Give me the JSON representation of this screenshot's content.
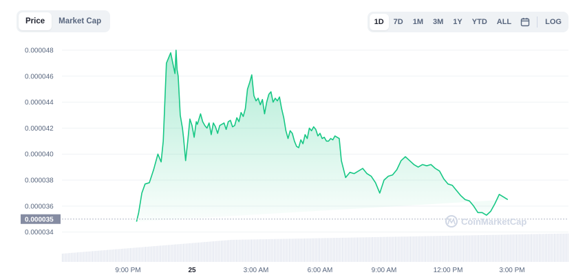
{
  "view_toggle": {
    "price_label": "Price",
    "market_cap_label": "Market Cap"
  },
  "ranges": {
    "d1": "1D",
    "d7": "7D",
    "m1": "1M",
    "m3": "3M",
    "y1": "1Y",
    "ytd": "YTD",
    "all": "ALL",
    "log": "LOG",
    "calendar_icon": "calendar-icon"
  },
  "watermark": "CoinMarketCap",
  "colors": {
    "line": "#16c784",
    "fill": "#16c784",
    "badge": "#858ca2",
    "volume": "#cfd6e4"
  },
  "chart_data": {
    "type": "area",
    "x_ticks": [
      "9:00 PM",
      "25",
      "3:00 AM",
      "6:00 AM",
      "9:00 AM",
      "12:00 PM",
      "3:00 PM"
    ],
    "y_ticks": [
      "0.000048",
      "0.000046",
      "0.000044",
      "0.000042",
      "0.000040",
      "0.000038",
      "0.000036",
      "0.000034"
    ],
    "current_price_label": "0.000035",
    "current_price": 3.5e-05,
    "ylim": [
      3.34e-05,
      4.9e-05
    ],
    "x_hours": [
      -2.6,
      -2.5,
      -2.35,
      -2.2,
      -2.0,
      -1.8,
      -1.6,
      -1.45,
      -1.35,
      -1.2,
      -1.0,
      -0.8,
      -0.75,
      -0.7,
      -0.65,
      -0.6,
      -0.55,
      -0.5,
      -0.45,
      -0.4,
      -0.3,
      -0.2,
      -0.1,
      0.0,
      0.1,
      0.2,
      0.25,
      0.4,
      0.5,
      0.6,
      0.7,
      0.8,
      0.9,
      1.0,
      1.1,
      1.2,
      1.3,
      1.4,
      1.5,
      1.6,
      1.7,
      1.8,
      1.9,
      2.0,
      2.1,
      2.2,
      2.3,
      2.4,
      2.5,
      2.6,
      2.7,
      2.8,
      2.9,
      3.0,
      3.1,
      3.2,
      3.3,
      3.4,
      3.5,
      3.6,
      3.7,
      3.8,
      3.9,
      4.0,
      4.1,
      4.2,
      4.3,
      4.4,
      4.5,
      4.6,
      4.7,
      4.8,
      4.9,
      5.0,
      5.1,
      5.2,
      5.3,
      5.4,
      5.5,
      5.6,
      5.7,
      5.8,
      5.9,
      6.0,
      6.1,
      6.2,
      6.3,
      6.4,
      6.5,
      6.6,
      6.7,
      6.8,
      6.9,
      7.0,
      7.2,
      7.4,
      7.6,
      7.8,
      8.0,
      8.2,
      8.4,
      8.6,
      8.8,
      9.0,
      9.2,
      9.4,
      9.6,
      9.8,
      10.0,
      10.2,
      10.4,
      10.6,
      10.8,
      11.0,
      11.2,
      11.4,
      11.6,
      11.8,
      12.0,
      12.2,
      12.4,
      12.6,
      12.8,
      13.0,
      13.2,
      13.4,
      13.6,
      13.8,
      14.0,
      14.2,
      14.4,
      14.6,
      14.8,
      15.0,
      15.2,
      15.4,
      15.6,
      15.8,
      16.0,
      16.2,
      16.4,
      16.6,
      16.8,
      17.0,
      17.2,
      17.4,
      17.6
    ],
    "values": [
      3.48e-05,
      3.55e-05,
      3.7e-05,
      3.77e-05,
      3.78e-05,
      3.88e-05,
      4e-05,
      3.94e-05,
      4.1e-05,
      4.7e-05,
      4.78e-05,
      4.62e-05,
      4.8e-05,
      4.65e-05,
      4.6e-05,
      4.45e-05,
      4.3e-05,
      4.25e-05,
      4.2e-05,
      4.13e-05,
      3.95e-05,
      4.1e-05,
      4.27e-05,
      4.22e-05,
      4.13e-05,
      4.25e-05,
      4.23e-05,
      4.31e-05,
      4.25e-05,
      4.22e-05,
      4.2e-05,
      4.24e-05,
      4.15e-05,
      4.24e-05,
      4.21e-05,
      4.16e-05,
      4.22e-05,
      4.23e-05,
      4.24e-05,
      4.19e-05,
      4.25e-05,
      4.26e-05,
      4.21e-05,
      4.22e-05,
      4.28e-05,
      4.25e-05,
      4.32e-05,
      4.29e-05,
      4.35e-05,
      4.5e-05,
      4.55e-05,
      4.61e-05,
      4.45e-05,
      4.41e-05,
      4.43e-05,
      4.38e-05,
      4.42e-05,
      4.31e-05,
      4.4e-05,
      4.46e-05,
      4.48e-05,
      4.4e-05,
      4.43e-05,
      4.41e-05,
      4.44e-05,
      4.35e-05,
      4.28e-05,
      4.18e-05,
      4.12e-05,
      4.18e-05,
      4.16e-05,
      4.1e-05,
      4.06e-05,
      4.05e-05,
      4.11e-05,
      4.08e-05,
      4.15e-05,
      4.12e-05,
      4.2e-05,
      4.18e-05,
      4.21e-05,
      4.19e-05,
      4.14e-05,
      4.16e-05,
      4.12e-05,
      4.13e-05,
      4.1e-05,
      4.1e-05,
      4.12e-05,
      4.11e-05,
      4.14e-05,
      4.13e-05,
      4.12e-05,
      3.95e-05,
      3.82e-05,
      3.86e-05,
      3.85e-05,
      3.87e-05,
      3.89e-05,
      3.85e-05,
      3.83e-05,
      3.78e-05,
      3.7e-05,
      3.8e-05,
      3.83e-05,
      3.84e-05,
      3.88e-05,
      3.95e-05,
      3.98e-05,
      3.95e-05,
      3.92e-05,
      3.9e-05,
      3.92e-05,
      3.91e-05,
      3.92e-05,
      3.89e-05,
      3.87e-05,
      3.81e-05,
      3.77e-05,
      3.76e-05,
      3.72e-05,
      3.68e-05,
      3.65e-05,
      3.64e-05,
      3.6e-05,
      3.55e-05,
      3.55e-05,
      3.53e-05,
      3.56e-05,
      3.62e-05,
      3.69e-05,
      3.67e-05,
      3.65e-05
    ]
  }
}
